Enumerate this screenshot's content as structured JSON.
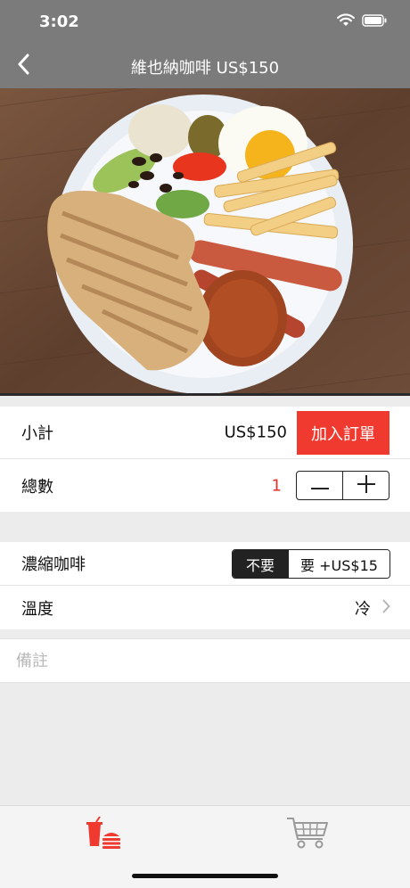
{
  "status_bar": {
    "time": "3:02"
  },
  "nav": {
    "title": "維也納咖啡 US$150"
  },
  "order": {
    "subtotal_label": "小計",
    "subtotal_price": "US$150",
    "add_button": "加入訂單",
    "quantity_label": "總數",
    "quantity_value": "1"
  },
  "options": {
    "espresso_label": "濃縮咖啡",
    "espresso_no": "不要",
    "espresso_yes": "要 +US$15",
    "temperature_label": "溫度",
    "temperature_value": "冷"
  },
  "note": {
    "placeholder": "備註"
  },
  "tabbar": {
    "items": [
      {
        "icon": "food-drink-icon",
        "active": true,
        "color": "#f03a2f"
      },
      {
        "icon": "cart-icon",
        "active": false,
        "color": "#9a9a9a"
      }
    ]
  },
  "colors": {
    "accent": "#f03a2f",
    "header": "#7b7b7b",
    "quantity": "#e0302a"
  }
}
